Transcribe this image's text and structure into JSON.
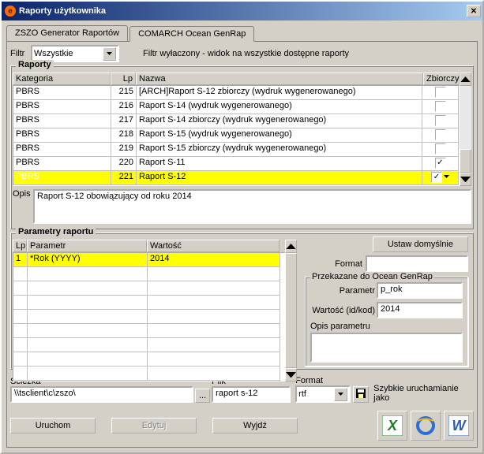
{
  "title": "Raporty użytkownika",
  "tabs": [
    "ZSZO Generator Raportów",
    "COMARCH Ocean GenRap"
  ],
  "filter": {
    "label": "Filtr",
    "value": "Wszystkie",
    "note": "Filtr wyłaczony - widok na wszystkie dostępne raporty"
  },
  "reports": {
    "groupTitle": "Raporty",
    "headers": {
      "cat": "Kategoria",
      "lp": "Lp",
      "name": "Nazwa",
      "zb": "Zbiorczy"
    },
    "rows": [
      {
        "cat": "PBRS",
        "lp": "215",
        "name": "[ARCH]Raport S-12 zbiorczy (wydruk wygenerowanego)",
        "zb": false
      },
      {
        "cat": "PBRS",
        "lp": "216",
        "name": "Raport S-14 (wydruk wygenerowanego)",
        "zb": false
      },
      {
        "cat": "PBRS",
        "lp": "217",
        "name": "Raport S-14 zbiorczy (wydruk wygenerowanego)",
        "zb": false
      },
      {
        "cat": "PBRS",
        "lp": "218",
        "name": "Raport S-15 (wydruk wygenerowanego)",
        "zb": false
      },
      {
        "cat": "PBRS",
        "lp": "219",
        "name": "Raport S-15 zbiorczy (wydruk wygenerowanego)",
        "zb": false
      },
      {
        "cat": "PBRS",
        "lp": "220",
        "name": "Raport S-11",
        "zb": true
      },
      {
        "cat": "PBRS",
        "lp": "221",
        "name": "Raport S-12",
        "zb": true
      }
    ],
    "descLabel": "Opis",
    "desc": "Raport S-12 obowiązujący od roku 2014"
  },
  "params": {
    "groupTitle": "Parametry raportu",
    "headers": {
      "lp": "Lp",
      "param": "Parametr",
      "val": "Wartość"
    },
    "rows": [
      {
        "lp": "1",
        "param": "*Rok (YYYY)",
        "val": "2014"
      }
    ],
    "setDefault": "Ustaw  domyślnie",
    "formatLabel": "Format",
    "formatValue": "",
    "pass": {
      "group": "Przekazane do Ocean GenRap",
      "pLabel": "Parametr",
      "pVal": "p_rok",
      "wLabel": "Wartość (id/kod)",
      "wVal": "2014",
      "opLabel": "Opis parametru",
      "opVal": ""
    }
  },
  "bottom": {
    "pathLabel": "Ścieżka",
    "pathVal": "\\\\tsclient\\c\\zszo\\",
    "fileLabel": "Plik",
    "fileVal": "raport s-12",
    "formatLabel": "Format",
    "formatVal": "rtf",
    "quickLabel": "Szybkie uruchamianie jako",
    "buttons": {
      "run": "Uruchom",
      "edit": "Edytuj",
      "exit": "Wyjdź"
    }
  }
}
